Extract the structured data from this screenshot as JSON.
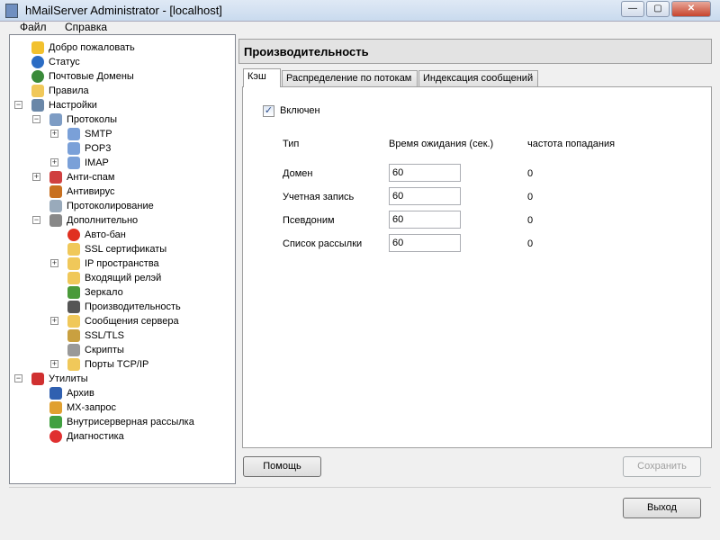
{
  "window": {
    "title": "hMailServer Administrator - [localhost]"
  },
  "menu": [
    "Файл",
    "Справка"
  ],
  "tree": [
    {
      "level": 0,
      "label": "Добро пожаловать",
      "icon": "star-icon",
      "color": "#f2c12e"
    },
    {
      "level": 0,
      "label": "Статус",
      "icon": "info-icon",
      "color": "#2b6cc4"
    },
    {
      "level": 0,
      "label": "Почтовые Домены",
      "icon": "globe-icon",
      "color": "#3a8a3a"
    },
    {
      "level": 0,
      "label": "Правила",
      "icon": "folder-icon",
      "color": "#f0c85a"
    },
    {
      "level": 0,
      "label": "Настройки",
      "icon": "tools-icon",
      "color": "#6a87a8",
      "exp": "-"
    },
    {
      "level": 1,
      "label": "Протоколы",
      "icon": "server-icon",
      "color": "#7d9cc4",
      "exp": "-"
    },
    {
      "level": 2,
      "label": "SMTP",
      "icon": "feather-icon",
      "color": "#7aa0d8",
      "exp": "+"
    },
    {
      "level": 2,
      "label": "POP3",
      "icon": "feather-icon",
      "color": "#7aa0d8"
    },
    {
      "level": 2,
      "label": "IMAP",
      "icon": "feather-icon",
      "color": "#7aa0d8",
      "exp": "+"
    },
    {
      "level": 1,
      "label": "Анти-спам",
      "icon": "no-entry-icon",
      "color": "#d04040",
      "exp": "+"
    },
    {
      "level": 1,
      "label": "Антивирус",
      "icon": "bug-icon",
      "color": "#c87020"
    },
    {
      "level": 1,
      "label": "Протоколирование",
      "icon": "log-icon",
      "color": "#9ab"
    },
    {
      "level": 1,
      "label": "Дополнительно",
      "icon": "magnifier-icon",
      "color": "#888",
      "exp": "-"
    },
    {
      "level": 2,
      "label": "Авто-бан",
      "icon": "red-circle-icon",
      "color": "#e03020"
    },
    {
      "level": 2,
      "label": "SSL сертификаты",
      "icon": "folder-icon",
      "color": "#f0c85a"
    },
    {
      "level": 2,
      "label": "IP пространства",
      "icon": "folder-icon",
      "color": "#f0c85a",
      "exp": "+"
    },
    {
      "level": 2,
      "label": "Входящий релэй",
      "icon": "folder-icon",
      "color": "#f0c85a"
    },
    {
      "level": 2,
      "label": "Зеркало",
      "icon": "mirror-icon",
      "color": "#4a9a3a"
    },
    {
      "level": 2,
      "label": "Производительность",
      "icon": "gauge-icon",
      "color": "#555"
    },
    {
      "level": 2,
      "label": "Сообщения сервера",
      "icon": "folder-icon",
      "color": "#f0c85a",
      "exp": "+"
    },
    {
      "level": 2,
      "label": "SSL/TLS",
      "icon": "certificate-icon",
      "color": "#c9a040"
    },
    {
      "level": 2,
      "label": "Скрипты",
      "icon": "script-icon",
      "color": "#999"
    },
    {
      "level": 2,
      "label": "Порты TCP/IP",
      "icon": "folder-icon",
      "color": "#f0c85a",
      "exp": "+"
    },
    {
      "level": 0,
      "label": "Утилиты",
      "icon": "knife-icon",
      "color": "#d03030",
      "exp": "-"
    },
    {
      "level": 1,
      "label": "Архив",
      "icon": "floppy-icon",
      "color": "#3060b0"
    },
    {
      "level": 1,
      "label": "MX-запрос",
      "icon": "compass-icon",
      "color": "#e0a030"
    },
    {
      "level": 1,
      "label": "Внутрисерверная рассылка",
      "icon": "dots-icon",
      "color": "#40a040"
    },
    {
      "level": 1,
      "label": "Диагностика",
      "icon": "heart-icon",
      "color": "#e03030"
    }
  ],
  "panel": {
    "title": "Производительность",
    "tabs": [
      "Кэш",
      "Распределение по потокам",
      "Индексация сообщений"
    ],
    "enabled_label": "Включен",
    "enabled": true,
    "columns": [
      "Тип",
      "Время ожидания (сек.)",
      "частота попадания"
    ],
    "rows": [
      {
        "type": "Домен",
        "timeout": "60",
        "hits": "0"
      },
      {
        "type": "Учетная запись",
        "timeout": "60",
        "hits": "0"
      },
      {
        "type": "Псевдоним",
        "timeout": "60",
        "hits": "0"
      },
      {
        "type": "Список рассылки",
        "timeout": "60",
        "hits": "0"
      }
    ],
    "help": "Помощь",
    "save": "Сохранить"
  },
  "exit": "Выход"
}
